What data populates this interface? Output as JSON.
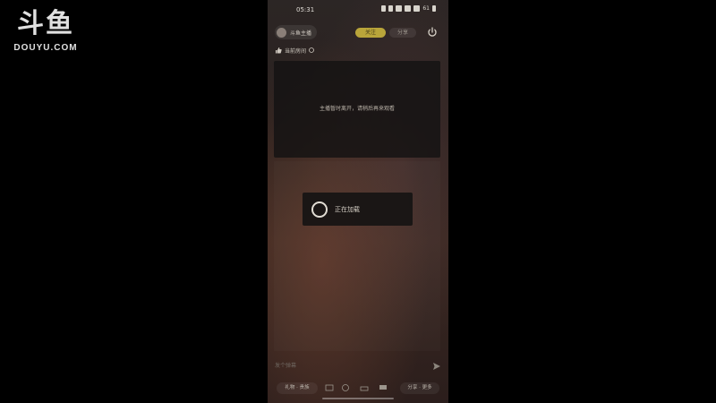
{
  "watermark": {
    "logo": "斗鱼",
    "site": "DOUYU.COM"
  },
  "statusbar": {
    "time": "05:31",
    "battery": "61"
  },
  "topbar": {
    "room_name": "斗鱼主播",
    "gold_pill": "关注",
    "dark_pill": "分享",
    "icons": {
      "power": "power-icon",
      "avatar": "avatar"
    }
  },
  "subline": {
    "text": "当前房间",
    "icon": "like-icon"
  },
  "panel": {
    "message": "主播暂时离开，请稍后再来观看"
  },
  "toast": {
    "text": "正在加载"
  },
  "input": {
    "placeholder": "发个弹幕"
  },
  "bottombar": {
    "left_button": "礼物 · 贵族",
    "right_button": "分享 · 更多"
  }
}
